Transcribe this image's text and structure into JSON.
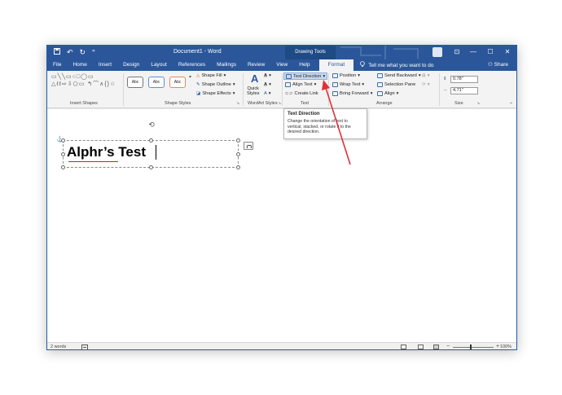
{
  "window": {
    "title": "Document1 - Word",
    "context_tab_group": "Drawing Tools",
    "qat": {
      "save_icon": "save-icon",
      "undo_label": "↶",
      "redo_label": "↻",
      "customize_label": "⩦"
    },
    "controls": {
      "ribbon_display": "⊡",
      "minimize": "—",
      "maximize": "☐",
      "close": "✕"
    }
  },
  "tabs": [
    {
      "label": "File"
    },
    {
      "label": "Home"
    },
    {
      "label": "Insert"
    },
    {
      "label": "Design"
    },
    {
      "label": "Layout"
    },
    {
      "label": "References"
    },
    {
      "label": "Mailings"
    },
    {
      "label": "Review"
    },
    {
      "label": "View"
    },
    {
      "label": "Help"
    },
    {
      "label": "Format"
    }
  ],
  "tell_me": "Tell me what you want to do",
  "share_label": "Share",
  "ribbon": {
    "groups": {
      "insert_shapes": "Insert Shapes",
      "shape_styles": "Shape Styles",
      "wordart_styles": "WordArt Styles",
      "text": "Text",
      "arrange": "Arrange",
      "size": "Size"
    },
    "shape_gallery_glyphs": "▭╲╲▭○□◯▭ △ℓℓ⇨⇩⬠▭ ↰⌒∧{}☆",
    "style_swatch_label": "Abc",
    "shape_fill": "Shape Fill",
    "shape_outline": "Shape Outline",
    "shape_effects": "Shape Effects",
    "quick_styles_1": "Quick",
    "quick_styles_2": "Styles",
    "text_direction": "Text Direction",
    "align_text": "Align Text",
    "create_link": "Create Link",
    "position": "Position",
    "wrap_text": "Wrap Text",
    "bring_forward": "Bring Forward",
    "send_backward": "Send Backward",
    "selection_pane": "Selection Pane",
    "align": "Align",
    "height_value": "0.78\"",
    "width_value": "4.71\""
  },
  "tooltip": {
    "title": "Text Direction",
    "body": "Change the orientation of text to vertical, stacked, or rotate it to the desired direction."
  },
  "document": {
    "textbox_text": "Alphr’s Test"
  },
  "statusbar": {
    "word_count": "2 words",
    "zoom_minus": "−",
    "zoom_plus": "+",
    "zoom_percent": "100%"
  },
  "colors": {
    "accent": "#2b579a",
    "annotation_arrow": "#e0313b"
  }
}
